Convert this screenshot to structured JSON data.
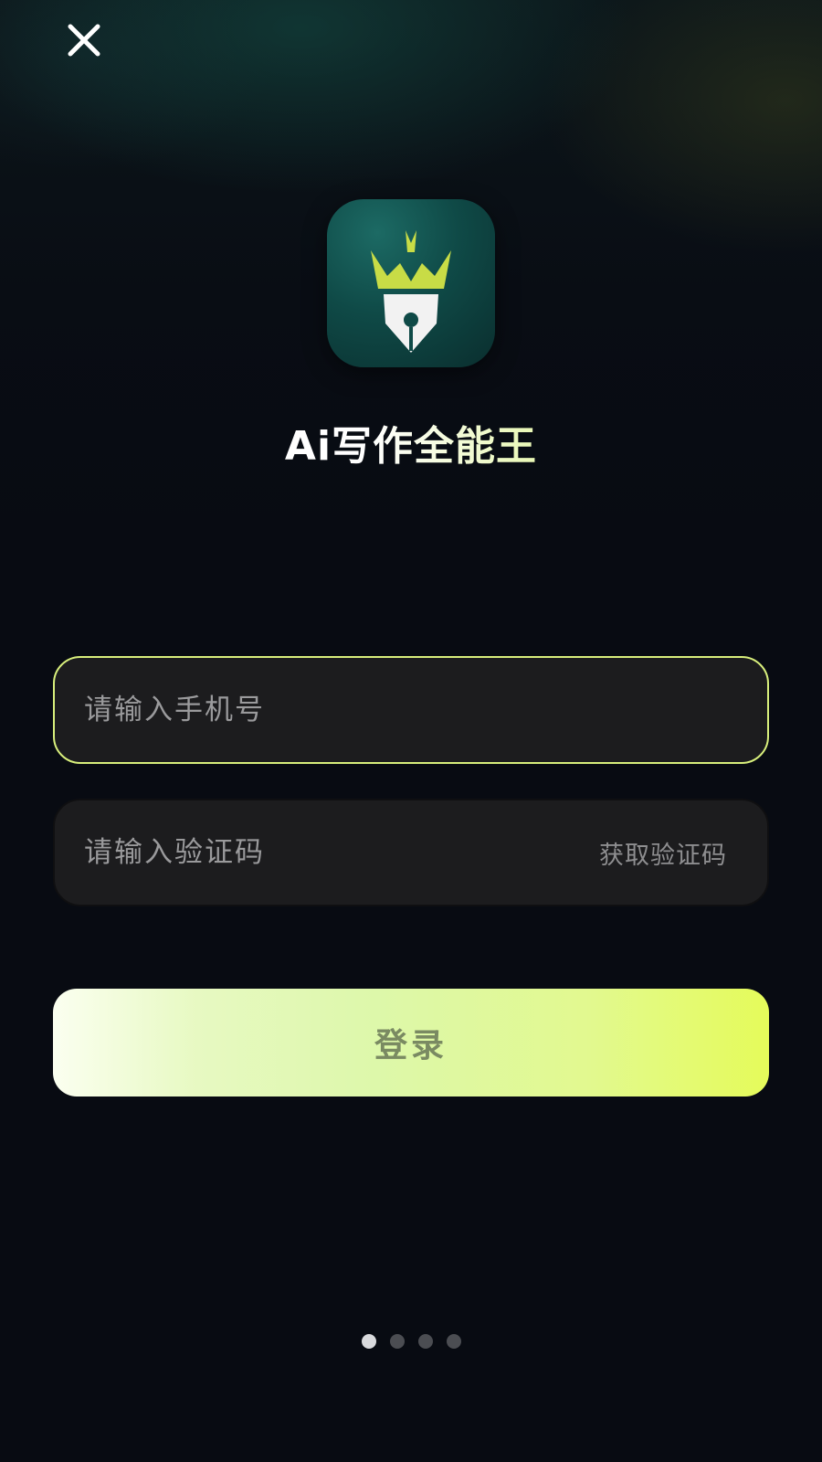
{
  "header": {
    "close_icon": "close-icon"
  },
  "brand": {
    "app_icon": "crown-pen-nib-logo",
    "app_name": "Ai写作全能王"
  },
  "form": {
    "phone_placeholder": "请输入手机号",
    "phone_value": "",
    "code_placeholder": "请输入验证码",
    "code_value": "",
    "get_code_label": "获取验证码",
    "login_label": "登录"
  },
  "pager": {
    "total": 4,
    "active_index": 0
  },
  "colors": {
    "accent": "#e3f957",
    "focus_border": "#d8ef7c",
    "background": "#080b12",
    "field_bg": "#1c1c1e"
  }
}
